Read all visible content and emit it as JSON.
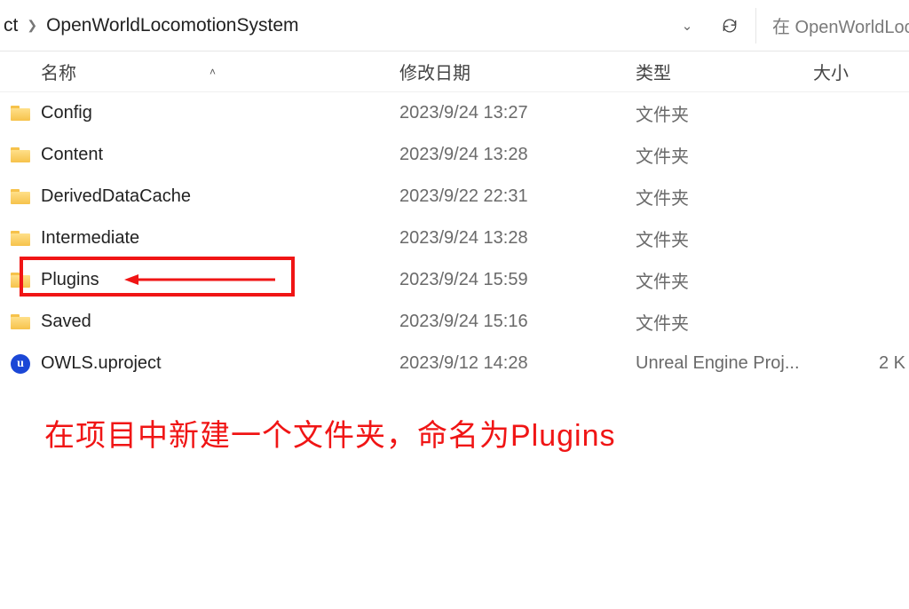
{
  "breadcrumb": {
    "prefix": "ct",
    "current": "OpenWorldLocomotionSystem"
  },
  "search": {
    "placeholder": "在 OpenWorldLoco"
  },
  "columns": {
    "name": "名称",
    "date": "修改日期",
    "type": "类型",
    "size": "大小"
  },
  "rows": [
    {
      "kind": "folder",
      "name": "Config",
      "date": "2023/9/24 13:27",
      "type": "文件夹",
      "size": ""
    },
    {
      "kind": "folder",
      "name": "Content",
      "date": "2023/9/24 13:28",
      "type": "文件夹",
      "size": ""
    },
    {
      "kind": "folder",
      "name": "DerivedDataCache",
      "date": "2023/9/22 22:31",
      "type": "文件夹",
      "size": ""
    },
    {
      "kind": "folder",
      "name": "Intermediate",
      "date": "2023/9/24 13:28",
      "type": "文件夹",
      "size": ""
    },
    {
      "kind": "folder",
      "name": "Plugins",
      "date": "2023/9/24 15:59",
      "type": "文件夹",
      "size": "",
      "highlight": true
    },
    {
      "kind": "folder",
      "name": "Saved",
      "date": "2023/9/24 15:16",
      "type": "文件夹",
      "size": ""
    },
    {
      "kind": "ue",
      "name": "OWLS.uproject",
      "date": "2023/9/12 14:28",
      "type": "Unreal Engine Proj...",
      "size": "2 K"
    }
  ],
  "caption": "在项目中新建一个文件夹，命名为Plugins"
}
